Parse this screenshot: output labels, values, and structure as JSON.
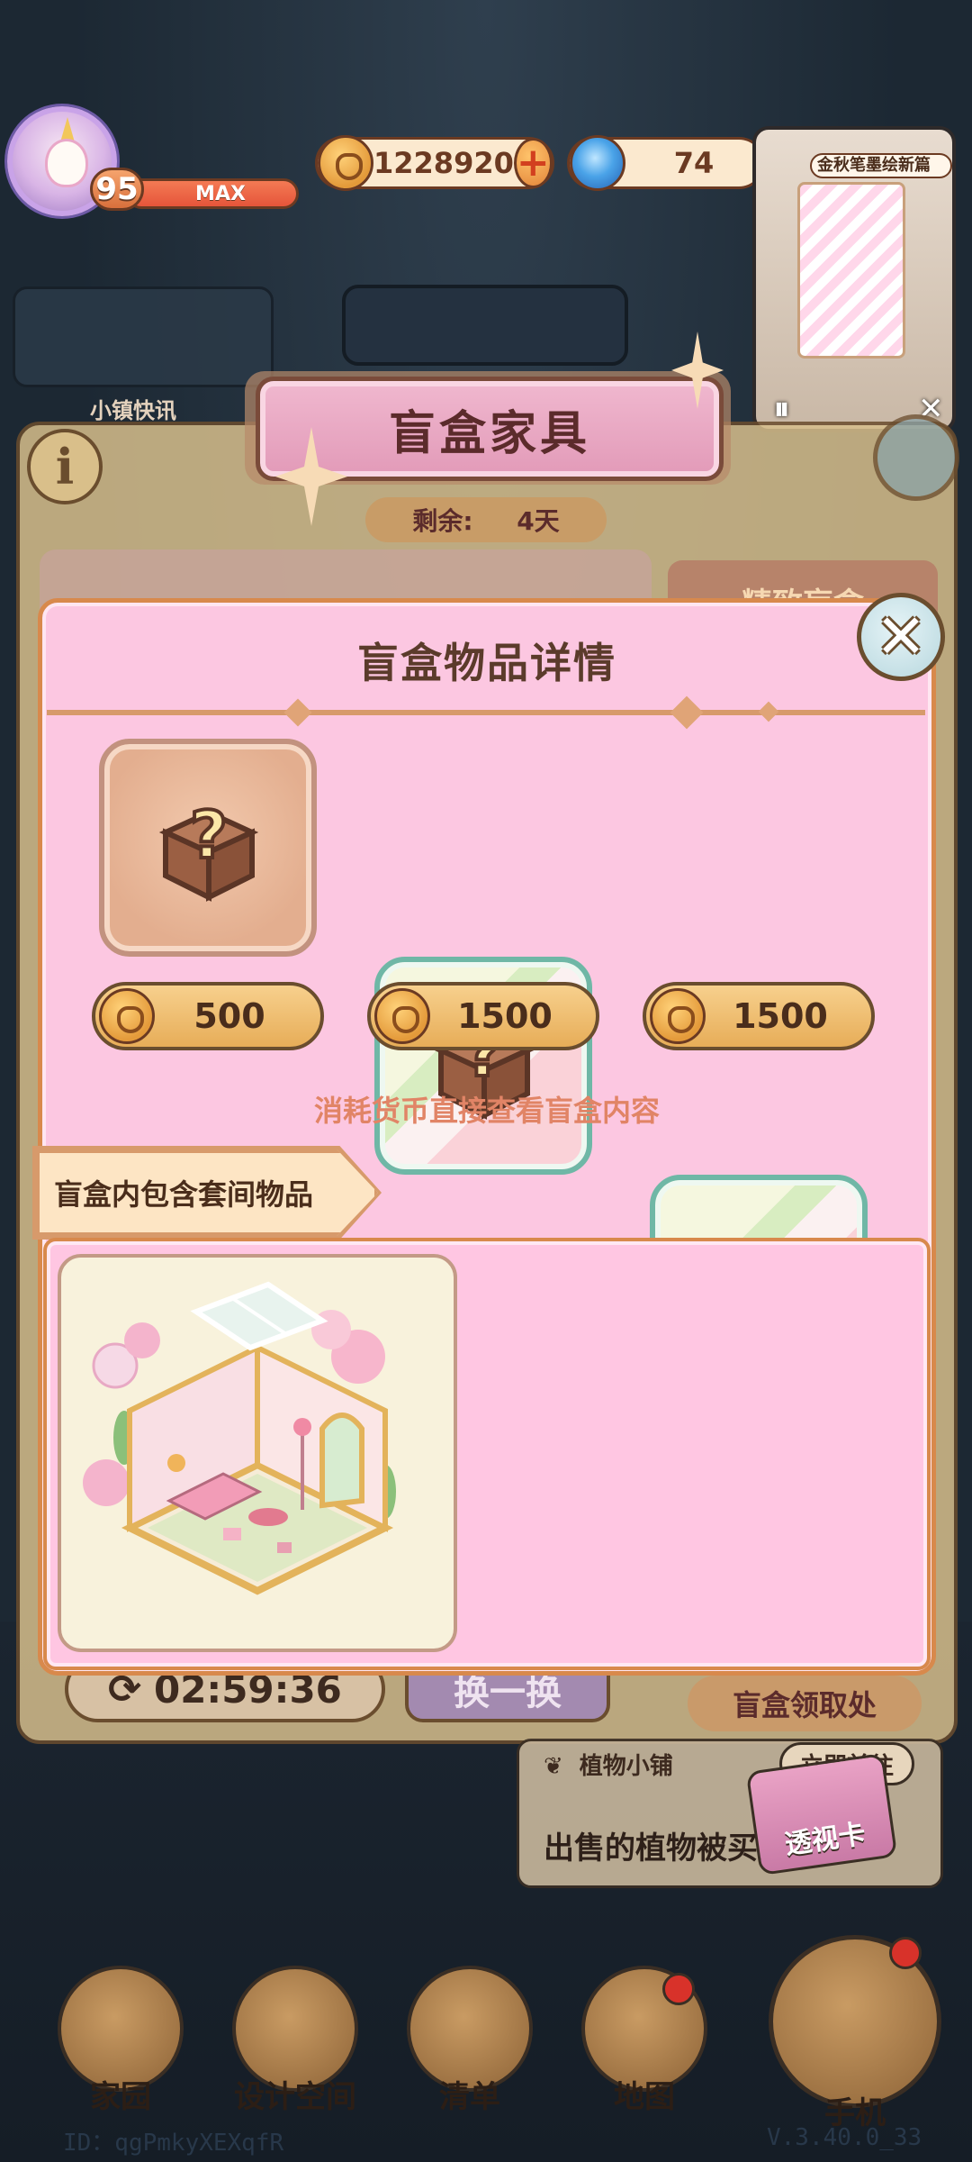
{
  "hud": {
    "level": "95",
    "level_bar": "MAX",
    "coins": "1228920",
    "gems": "74"
  },
  "pip": {
    "title": "金秋笔墨绘新篇"
  },
  "background_banner": {
    "left_label": "小镇快讯"
  },
  "main_panel": {
    "title": "盲盒家具",
    "remaining_label": "剩余:",
    "remaining_value": "4天",
    "right_tab": "精致盲盒",
    "timer": "02:59:36",
    "swap_button": "换一换",
    "claim_label": "盲盒领取处"
  },
  "detail_modal": {
    "title": "盲盒物品详情",
    "boxes": [
      {
        "price": "500",
        "style": "tan"
      },
      {
        "price": "1500",
        "style": "green"
      },
      {
        "price": "1500",
        "style": "green"
      }
    ],
    "consume_hint": "消耗货币直接查看盲盒内容",
    "section_tag": "盲盒内包含套间物品"
  },
  "notice": {
    "shop": "植物小铺",
    "goto": "立即前往",
    "message": "出售的植物被买走了！",
    "xray_card": "透视卡"
  },
  "nav": {
    "home": "家园",
    "design": "设计空间",
    "list": "清单",
    "map": "地图",
    "phone": "手机"
  },
  "footer": {
    "id": "ID：qgPmkyXEXqfR",
    "version": "V.3.40.0_33"
  },
  "colors": {
    "modal_pink": "#fcc7e1",
    "accent_orange": "#d8894c",
    "hint_text": "#e18466",
    "coin_gold": "#e7ad58"
  }
}
